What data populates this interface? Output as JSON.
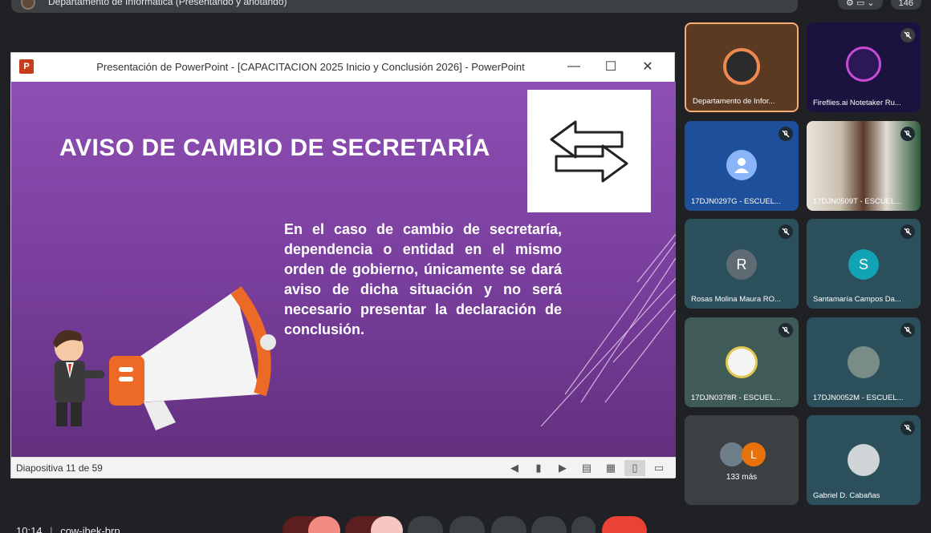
{
  "meeting": {
    "presenter_bar_title": "Departamento de Informática (Presentando y anotando)",
    "top_right_count": "146",
    "clock": "10:14",
    "separator": "|",
    "meeting_code": "cow-ibek-brp"
  },
  "powerpoint": {
    "window_title": "Presentación de PowerPoint - [CAPACITACION 2025 Inicio y Conclusión 2026] - PowerPoint",
    "minimize": "—",
    "maximize": "☐",
    "close": "✕",
    "status": "Diapositiva 11 de 59",
    "slide": {
      "title": "AVISO DE CAMBIO DE SECRETARÍA",
      "body": "En el caso de cambio de secretaría, dependencia o entidad en el mismo orden de gobierno, únicamente se dará aviso de dicha situación y no será necesario presentar la declaración de conclusión."
    }
  },
  "participants": [
    {
      "name": "Departamento de Infor...",
      "type": "logo"
    },
    {
      "name": "Fireflies.ai Notetaker Ru...",
      "type": "fireflies"
    },
    {
      "name": "17DJN0297G - ESCUEL...",
      "type": "default-avatar"
    },
    {
      "name": "17DJN0509T - ESCUEL...",
      "type": "video"
    },
    {
      "name": "Rosas Molina Maura RO...",
      "type": "letter",
      "letter": "R",
      "color": "#5f6b73"
    },
    {
      "name": "Santamaría Campos Da...",
      "type": "letter",
      "letter": "S",
      "color": "#12a4b4"
    },
    {
      "name": "17DJN0378R - ESCUEL...",
      "type": "image"
    },
    {
      "name": "17DJN0052M - ESCUEL...",
      "type": "image"
    },
    {
      "name": "133 más",
      "type": "more",
      "letter": "L",
      "color": "#e8710a"
    },
    {
      "name": "Gabriel D. Cabañas",
      "type": "image"
    }
  ],
  "colors": {
    "slide_purple": "#8d4fb3",
    "ppt_red": "#c43e1c",
    "hangup_red": "#ea4335",
    "tile_highlight": "#f6ad72"
  }
}
